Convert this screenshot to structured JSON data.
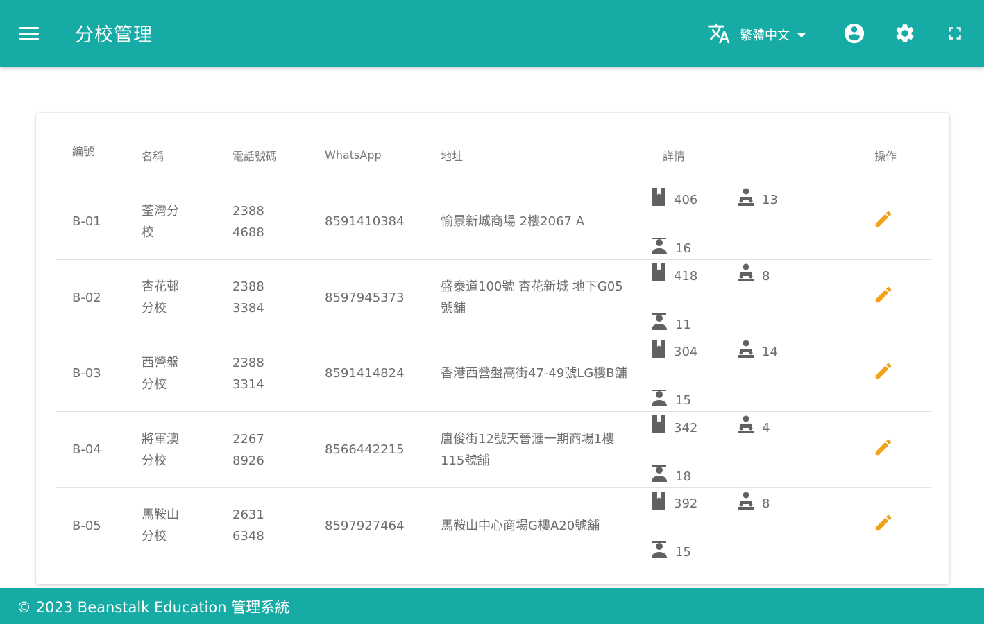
{
  "header": {
    "title": "分校管理",
    "language": "繁體中文",
    "menu_icon": "menu-icon",
    "translate_icon": "translate-icon",
    "account_icon": "account-circle-icon",
    "settings_icon": "settings-icon",
    "fullscreen_icon": "fullscreen-icon",
    "bar_color": "#17aba5"
  },
  "table": {
    "columns": {
      "code": "編號",
      "name": "名稱",
      "phone": "電話號碼",
      "whatsapp": "WhatsApp",
      "address": "地址",
      "details": "詳情",
      "actions": "操作"
    },
    "rows": [
      {
        "code": "B-01",
        "name": "荃灣分校",
        "phone": "2388 4688",
        "whatsapp": "8591410384",
        "address": "愉景新城商場 2樓2067 A",
        "count_a": "406",
        "count_b": "13",
        "count_c": "16"
      },
      {
        "code": "B-02",
        "name": "杏花邨分校",
        "phone": "2388 3384",
        "whatsapp": "8597945373",
        "address": "盛泰道100號 杏花新城 地下G05號舖",
        "count_a": "418",
        "count_b": "8",
        "count_c": "11"
      },
      {
        "code": "B-03",
        "name": "西營盤分校",
        "phone": "2388 3314",
        "whatsapp": "8591414824",
        "address": "香港西營盤高街47-49號LG樓B舖",
        "count_a": "304",
        "count_b": "14",
        "count_c": "15"
      },
      {
        "code": "B-04",
        "name": "將軍澳分校",
        "phone": "2267 8926",
        "whatsapp": "8566442215",
        "address": "唐俊街12號天晉滙一期商場1樓115號舖",
        "count_a": "342",
        "count_b": "4",
        "count_c": "18"
      },
      {
        "code": "B-05",
        "name": "馬鞍山分校",
        "phone": "2631 6348",
        "whatsapp": "8597927464",
        "address": "馬鞍山中心商場G樓A20號舖",
        "count_a": "392",
        "count_b": "8",
        "count_c": "15"
      }
    ],
    "detail_icons": [
      "book-icon",
      "group-icon",
      "teacher-icon"
    ],
    "edit_icon": "pencil-icon",
    "edit_color": "#f2a11b"
  },
  "footer": {
    "text": "© 2023 Beanstalk Education 管理系統"
  }
}
